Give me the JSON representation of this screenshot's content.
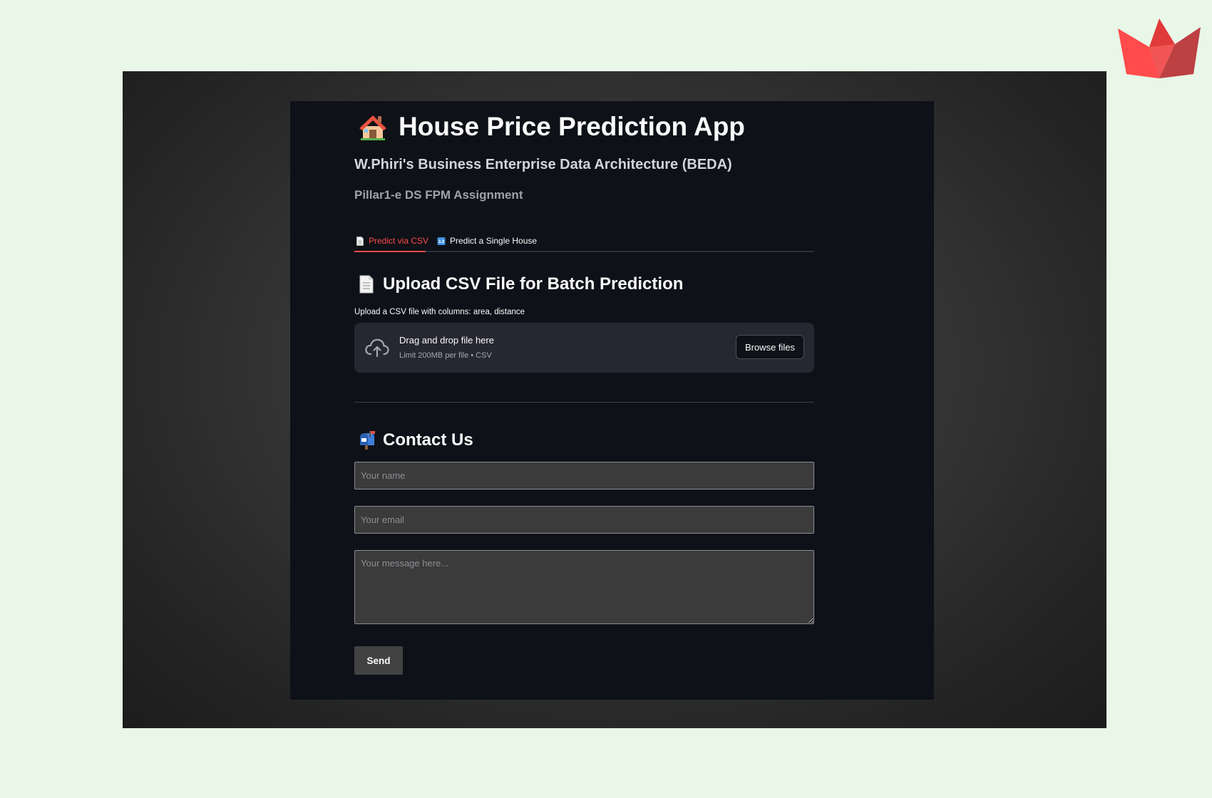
{
  "colors": {
    "page_background": "#e9f7e8",
    "app_background": "#0e1117",
    "accent": "#ff4b4b",
    "dropzone": "#262730",
    "input_background": "#3b3b3b"
  },
  "header": {
    "icon": "house-icon",
    "title": "House Price Prediction App",
    "subtitle": "W.Phiri's Business Enterprise Data Architecture (BEDA)",
    "caption": "Pillar1-e DS FPM Assignment"
  },
  "tabs": [
    {
      "label": "Predict via CSV",
      "icon": "page-facing-up-icon",
      "active": true
    },
    {
      "label": "Predict a Single House",
      "icon": "input-numbers-icon",
      "active": false
    }
  ],
  "upload_section": {
    "icon": "page-facing-up-icon",
    "title": "Upload CSV File for Batch Prediction",
    "uploader_label": "Upload a CSV file with columns: area, distance",
    "dropzone": {
      "icon": "cloud-upload-icon",
      "primary_text": "Drag and drop file here",
      "secondary_text": "Limit 200MB per file • CSV",
      "button_label": "Browse files"
    }
  },
  "contact_section": {
    "icon": "mailbox-icon",
    "title": "Contact Us",
    "name_field": {
      "value": "",
      "placeholder": "Your name"
    },
    "email_field": {
      "value": "",
      "placeholder": "Your email"
    },
    "message_field": {
      "value": "",
      "placeholder": "Your message here..."
    },
    "send_label": "Send"
  },
  "branding": {
    "logo_icon": "streamlit-crown-logo-icon"
  }
}
